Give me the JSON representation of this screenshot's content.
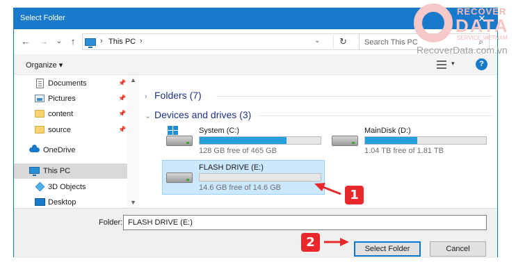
{
  "window": {
    "title": "Select Folder",
    "close_glyph": "✕"
  },
  "nav": {
    "back": "←",
    "forward": "→",
    "recent": "⌄",
    "up": "↑",
    "address": {
      "location": "This PC",
      "sep": "›",
      "dropdown": "⌄",
      "refresh": "↻"
    },
    "search": {
      "placeholder": "Search This PC",
      "icon": "⌕"
    }
  },
  "toolbar": {
    "organize": "Organize ▾",
    "view_dropdown": "▾",
    "help": "?"
  },
  "sidebar": {
    "items": [
      {
        "label": "Documents",
        "icon": "document-icon",
        "pinned": true
      },
      {
        "label": "Pictures",
        "icon": "pictures-icon",
        "pinned": true
      },
      {
        "label": "content",
        "icon": "folder-icon",
        "pinned": true
      },
      {
        "label": "source",
        "icon": "folder-icon",
        "pinned": true
      },
      {
        "label": "OneDrive",
        "icon": "onedrive-icon"
      },
      {
        "label": "This PC",
        "icon": "this-pc-icon",
        "selected": true
      },
      {
        "label": "3D Objects",
        "icon": "objects-3d-icon"
      },
      {
        "label": "Desktop",
        "icon": "desktop-icon"
      }
    ],
    "pin_glyph": "📌",
    "scroll_up": "▲",
    "scroll_down": "▼"
  },
  "main": {
    "groups": [
      {
        "label": "Folders (7)",
        "chevron": "›",
        "expanded": false
      },
      {
        "label": "Devices and drives (3)",
        "chevron": "⌄",
        "expanded": true
      }
    ],
    "drives": [
      {
        "name": "System (C:)",
        "free": "128 GB free of 465 GB",
        "used_fraction": 0.72,
        "os": true
      },
      {
        "name": "MainDisk (D:)",
        "free": "1.04 TB free of 1.81 TB",
        "used_fraction": 0.43
      },
      {
        "name": "FLASH DRIVE (E:)",
        "free": "14.6 GB free of 14.6 GB",
        "used_fraction": 0.0,
        "selected": true
      }
    ]
  },
  "footer": {
    "folder_label": "Folder:",
    "folder_value": "FLASH DRIVE (E:)",
    "select_button": "Select Folder",
    "cancel_button": "Cancel"
  },
  "annotations": {
    "step1": "1",
    "step2": "2",
    "color": "#e8282b"
  },
  "watermark": {
    "brand_top": "RECOVER",
    "brand_main": "DATA",
    "tagline": "SERVICE VIETNAM",
    "url": "RecoverData.com.vn"
  },
  "colors": {
    "accent": "#1979ca",
    "drive_bar": "#26a0da",
    "selection": "#cce8ff"
  }
}
